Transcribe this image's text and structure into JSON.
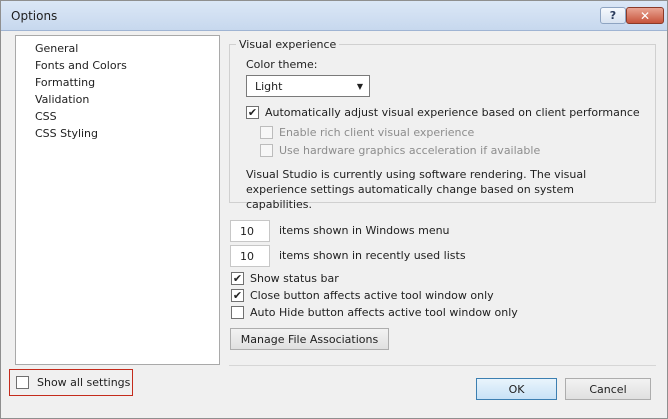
{
  "window": {
    "title": "Options",
    "help_glyph": "?",
    "close_glyph": "✕"
  },
  "nav": {
    "items": [
      {
        "label": "General"
      },
      {
        "label": "Fonts and Colors"
      },
      {
        "label": "Formatting"
      },
      {
        "label": "Validation"
      },
      {
        "label": "CSS"
      },
      {
        "label": "CSS Styling"
      }
    ]
  },
  "show_all": {
    "label": "Show all settings",
    "checked": false
  },
  "visual_experience": {
    "group_title": "Visual experience",
    "color_theme_label": "Color theme:",
    "color_theme_value": "Light",
    "auto_adjust": {
      "label": "Automatically adjust visual experience based on client performance",
      "checked": true
    },
    "rich_client": {
      "label": "Enable rich client visual experience",
      "checked": false,
      "enabled": false
    },
    "hw_accel": {
      "label": "Use hardware graphics acceleration if available",
      "checked": false,
      "enabled": false
    },
    "description": "Visual Studio is currently using software rendering.  The visual experience settings automatically change based on system capabilities."
  },
  "windows_menu": {
    "value": "10",
    "label": "items shown in Windows menu"
  },
  "recent_lists": {
    "value": "10",
    "label": "items shown in recently used lists"
  },
  "options": {
    "status_bar": {
      "label": "Show status bar",
      "checked": true
    },
    "close_button": {
      "label": "Close button affects active tool window only",
      "checked": true
    },
    "auto_hide": {
      "label": "Auto Hide button affects active tool window only",
      "checked": false
    }
  },
  "buttons": {
    "manage_assoc": "Manage File Associations",
    "ok": "OK",
    "cancel": "Cancel"
  },
  "glyphs": {
    "check": "✔",
    "dropdown_arrow": "▼"
  }
}
